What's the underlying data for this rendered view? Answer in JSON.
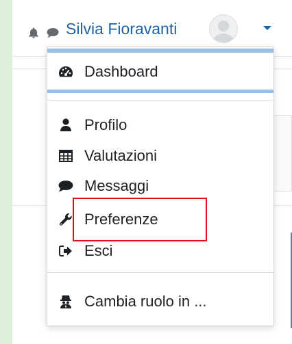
{
  "navbar": {
    "user_name": "Silvia Fioravanti",
    "notification_icon": "bell-icon",
    "messages_icon": "chat-icon",
    "avatar_icon": "user-avatar-icon",
    "menu_toggle_icon": "caret-down-icon"
  },
  "user_menu": {
    "items": [
      {
        "label": "Dashboard",
        "icon": "tachometer-icon"
      },
      {
        "label": "Profilo",
        "icon": "user-icon"
      },
      {
        "label": "Valutazioni",
        "icon": "table-icon"
      },
      {
        "label": "Messaggi",
        "icon": "comment-icon"
      },
      {
        "label": "Preferenze",
        "icon": "wrench-icon"
      },
      {
        "label": "Esci",
        "icon": "sign-out-icon"
      },
      {
        "label": "Cambia ruolo in ...",
        "icon": "user-secret-icon"
      }
    ],
    "highlighted_item": "Preferenze"
  },
  "colors": {
    "link": "#1f62a4",
    "active_bar": "#97bfe8",
    "highlight_border": "#e0101a",
    "outer_background": "#dfeeda"
  }
}
